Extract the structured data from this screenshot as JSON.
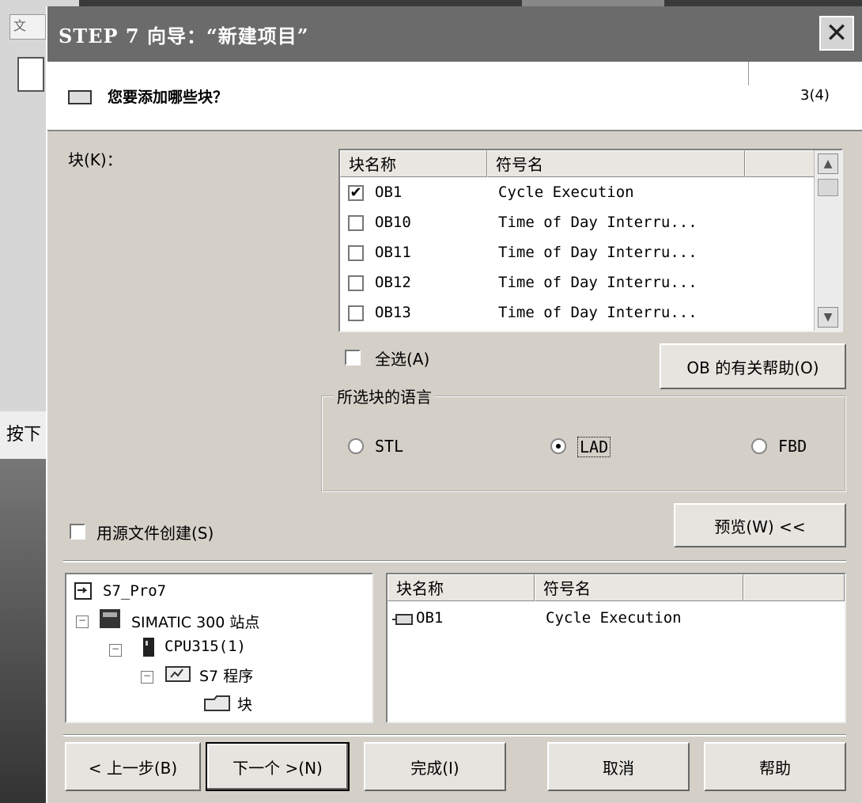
{
  "background": {
    "menu_fragment": "文",
    "status_fragment": "按下"
  },
  "dialog": {
    "title": "STEP 7 向导：“新建项目”",
    "close_symbol": "✕"
  },
  "header": {
    "question": "您要添加哪些块？",
    "step": "3(4)"
  },
  "blocks": {
    "label": "块(K)：",
    "columns": [
      "块名称",
      "符号名"
    ],
    "rows": [
      {
        "name": "OB1",
        "symbol": "Cycle Execution",
        "checked": true
      },
      {
        "name": "OB10",
        "symbol": "Time of Day Interru...",
        "checked": false
      },
      {
        "name": "OB11",
        "symbol": "Time of Day Interru...",
        "checked": false
      },
      {
        "name": "OB12",
        "symbol": "Time of Day Interru...",
        "checked": false
      },
      {
        "name": "OB13",
        "symbol": "Time of Day Interru...",
        "checked": false
      }
    ],
    "check_mark": "✔",
    "scroll_up": "▲",
    "scroll_down": "▼"
  },
  "select_all": {
    "label": "全选(A)"
  },
  "ob_help_button": "OB 的有关帮助(O)",
  "language": {
    "legend": "所选块的语言",
    "options": [
      "STL",
      "LAD",
      "FBD"
    ],
    "selected": "LAD"
  },
  "source_file": {
    "label": "用源文件创建(S)"
  },
  "preview_button": "预览(W) <<",
  "tree": {
    "project": "S7_Pro7",
    "station": "SIMATIC 300 站点",
    "cpu": "CPU315(1)",
    "program": "S7 程序",
    "blocks": "块",
    "expand_symbol": "−"
  },
  "preview_list": {
    "columns": [
      "块名称",
      "符号名"
    ],
    "rows": [
      {
        "name": "OB1",
        "symbol": "Cycle Execution"
      }
    ]
  },
  "footer": {
    "back": "< 上一步(B)",
    "next": "下一个 >(N)",
    "finish": "完成(I)",
    "cancel": "取消",
    "help": "帮助"
  }
}
